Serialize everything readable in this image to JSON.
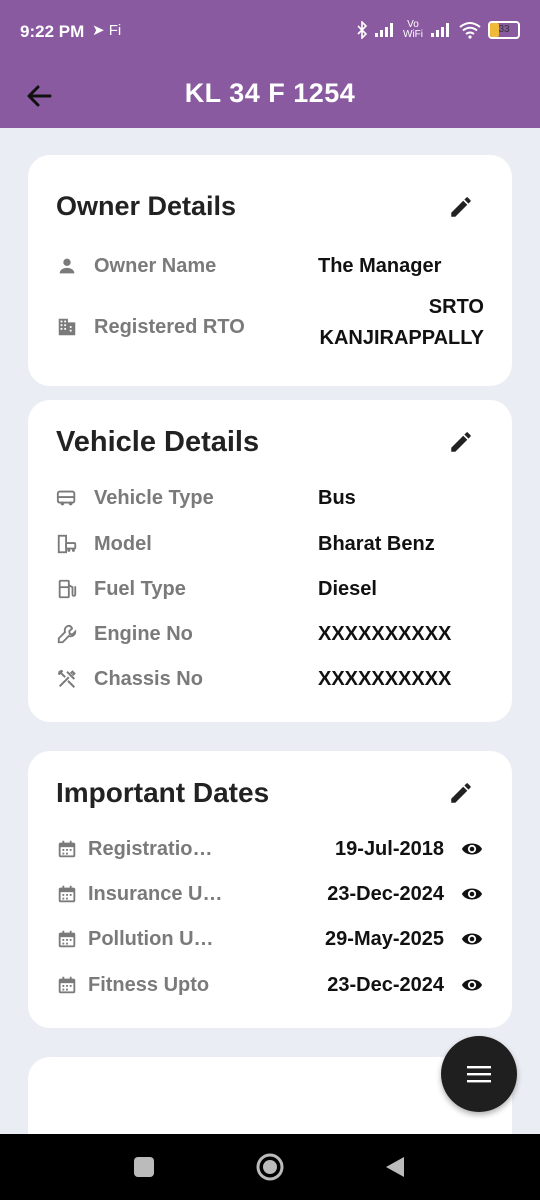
{
  "status_bar": {
    "time": "9:22 PM",
    "left_icons": "➤ Fi",
    "network": "Vo WiFi",
    "battery": "33"
  },
  "app_bar": {
    "title": "KL 34 F 1254"
  },
  "owner_details": {
    "heading": "Owner Details",
    "rows": [
      {
        "label": "Owner Name",
        "value": "The Manager",
        "icon": "person-icon"
      },
      {
        "label": "Registered RTO",
        "value_line1": "SRTO",
        "value_line2": "KANJIRAPPALLY",
        "icon": "building-icon"
      }
    ]
  },
  "vehicle_details": {
    "heading": "Vehicle Details",
    "rows": [
      {
        "label": "Vehicle Type",
        "value": "Bus",
        "icon": "bus-icon"
      },
      {
        "label": "Model",
        "value": "Bharat Benz",
        "icon": "car-model-icon"
      },
      {
        "label": "Fuel Type",
        "value": "Diesel",
        "icon": "fuel-icon"
      },
      {
        "label": "Engine No",
        "value": "XXXXXXXXXX",
        "icon": "wrench-icon"
      },
      {
        "label": "Chassis No",
        "value": "XXXXXXXXXX",
        "icon": "tools-icon"
      }
    ]
  },
  "important_dates": {
    "heading": "Important Dates",
    "rows": [
      {
        "label": "Registratio…",
        "value": "19-Jul-2018",
        "icon": "calendar-icon"
      },
      {
        "label": "Insurance U…",
        "value": "23-Dec-2024",
        "icon": "calendar-icon"
      },
      {
        "label": "Pollution U…",
        "value": "29-May-2025",
        "icon": "calendar-icon"
      },
      {
        "label": "Fitness Upto",
        "value": "23-Dec-2024",
        "icon": "calendar-icon"
      }
    ]
  },
  "colors": {
    "app_bar": "#8a5aa0",
    "background": "#eaedf3",
    "card": "#ffffff",
    "fab": "#1f1f1f"
  }
}
